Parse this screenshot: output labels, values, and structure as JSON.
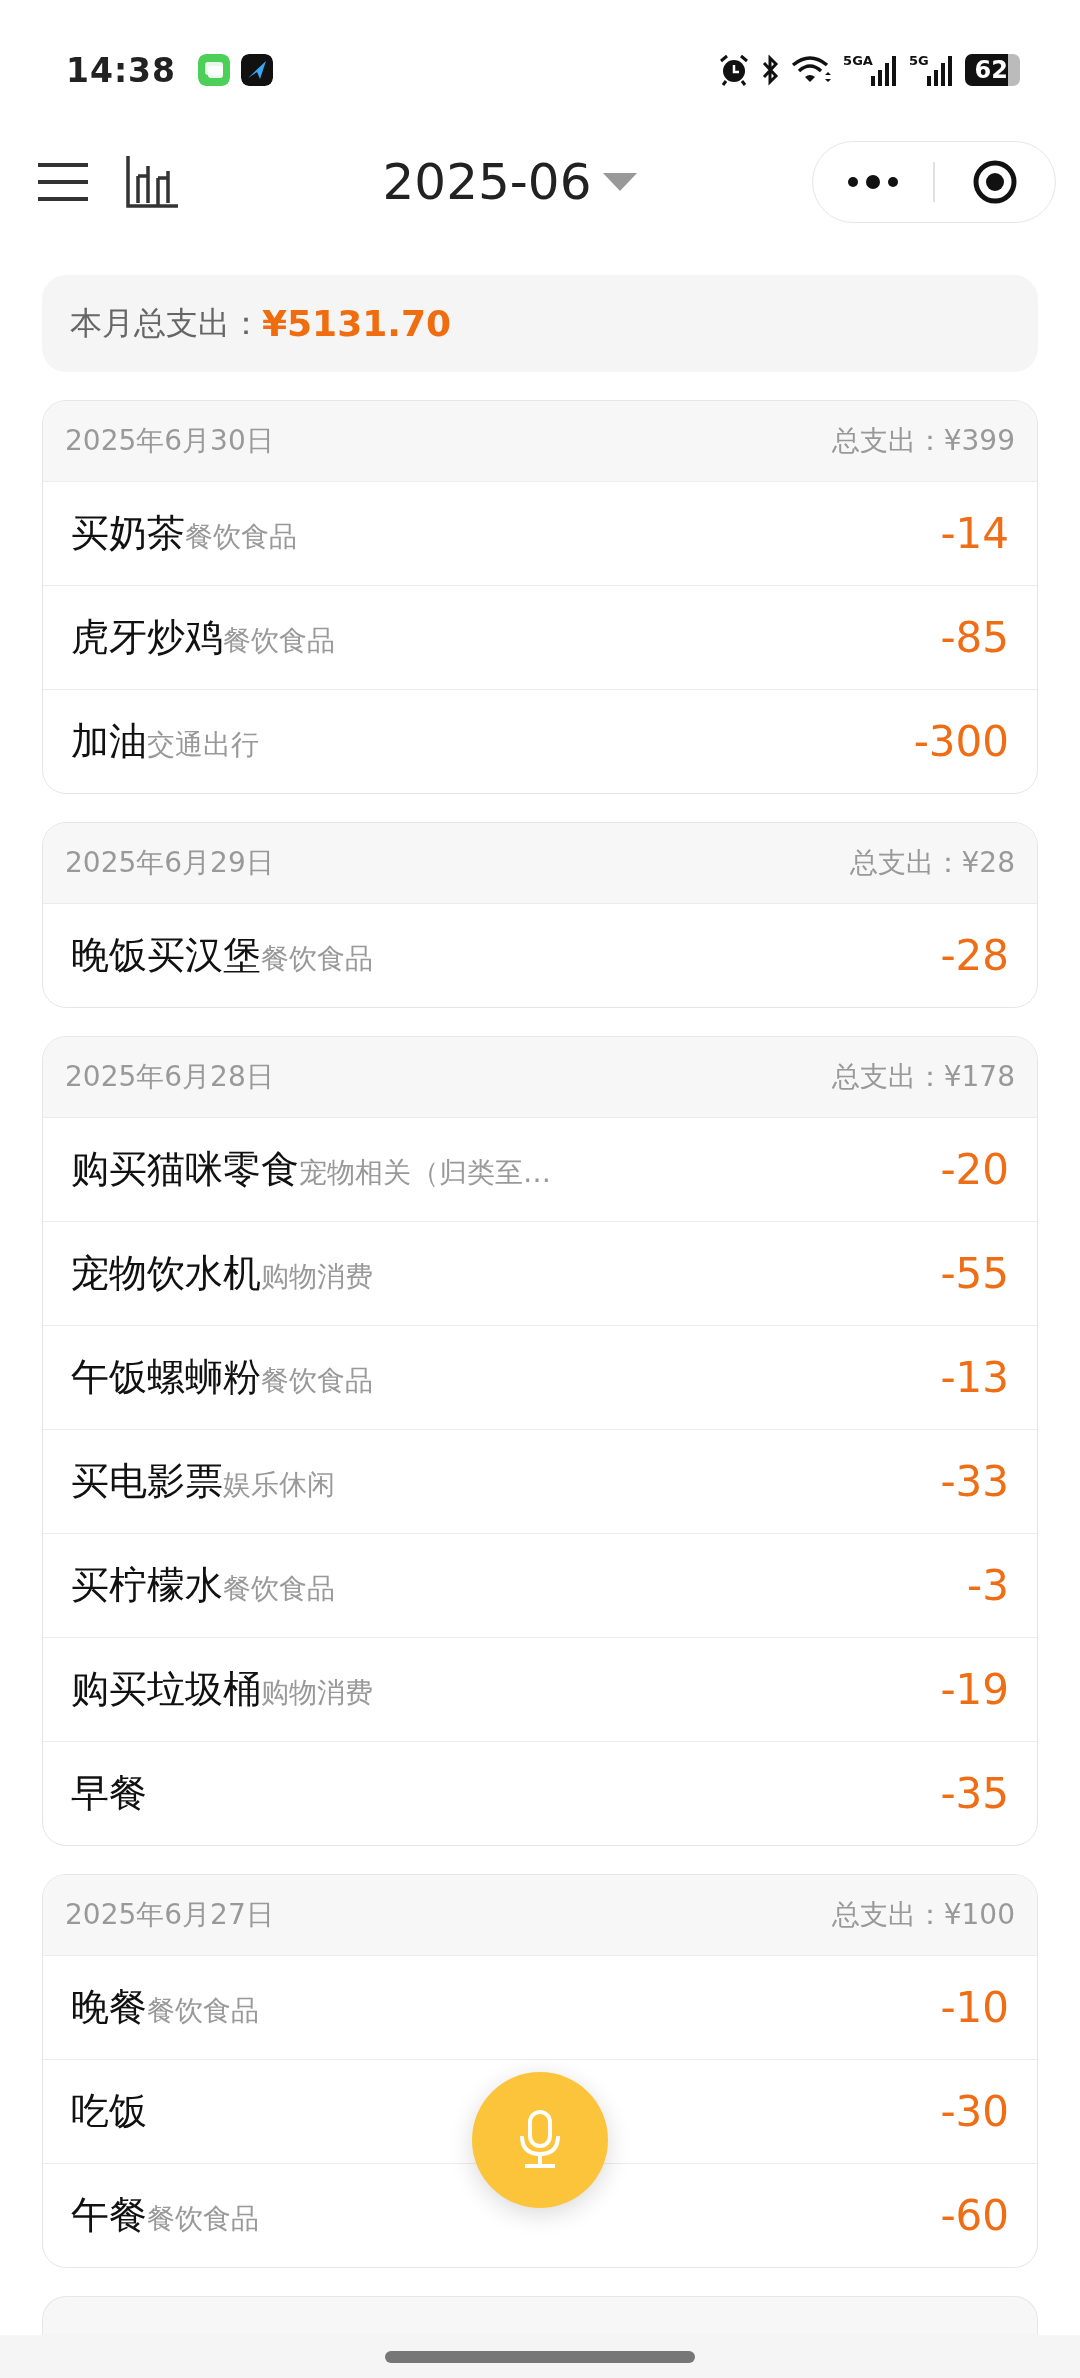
{
  "status_bar": {
    "time": "14:38",
    "network_1": "5GA",
    "network_2": "5G",
    "battery": "62"
  },
  "header": {
    "month": "2025-06"
  },
  "summary": {
    "label": "本月总支出：",
    "amount": "¥5131.70"
  },
  "days": [
    {
      "date": "2025年6月30日",
      "total": "总支出：¥399",
      "entries": [
        {
          "title": "买奶茶",
          "category": "餐饮食品",
          "amount": "-14"
        },
        {
          "title": "虎牙炒鸡",
          "category": "餐饮食品",
          "amount": "-85"
        },
        {
          "title": "加油",
          "category": "交通出行",
          "amount": "-300"
        }
      ]
    },
    {
      "date": "2025年6月29日",
      "total": "总支出：¥28",
      "entries": [
        {
          "title": "晚饭买汉堡",
          "category": "餐饮食品",
          "amount": "-28"
        }
      ]
    },
    {
      "date": "2025年6月28日",
      "total": "总支出：¥178",
      "entries": [
        {
          "title": "购买猫咪零食",
          "category": "宠物相关（归类至…",
          "amount": "-20"
        },
        {
          "title": "宠物饮水机",
          "category": "购物消费",
          "amount": "-55"
        },
        {
          "title": "午饭螺蛳粉",
          "category": "餐饮食品",
          "amount": "-13"
        },
        {
          "title": "买电影票",
          "category": "娱乐休闲",
          "amount": "-33"
        },
        {
          "title": "买柠檬水",
          "category": "餐饮食品",
          "amount": "-3"
        },
        {
          "title": "购买垃圾桶",
          "category": "购物消费",
          "amount": "-19"
        },
        {
          "title": "早餐",
          "amount": "-35"
        }
      ]
    },
    {
      "date": "2025年6月27日",
      "total": "总支出：¥100",
      "entries": [
        {
          "title": "晚餐",
          "category": "餐饮食品",
          "amount": "-10"
        },
        {
          "title": "吃饭",
          "amount": "-30"
        },
        {
          "title": "午餐",
          "category": "餐饮食品",
          "amount": "-60"
        }
      ]
    }
  ]
}
